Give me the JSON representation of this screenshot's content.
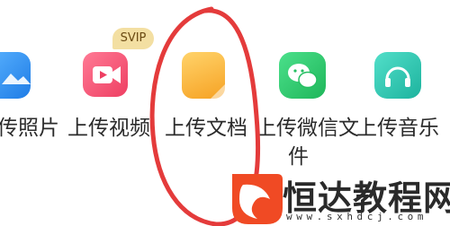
{
  "upload_options": [
    {
      "label": "传照片",
      "icon": "photo-icon",
      "color": "#2e8cf2"
    },
    {
      "label": "上传视频",
      "icon": "video-icon",
      "color": "#f04f6e",
      "badge": "SVIP"
    },
    {
      "label": "上传文档",
      "icon": "document-icon",
      "color": "#f8b53c"
    },
    {
      "label": "上传微信文",
      "label_line2": "件",
      "icon": "wechat-icon",
      "color": "#2ecb69"
    },
    {
      "label": "上传音乐",
      "icon": "music-icon",
      "color": "#2bc7b1"
    }
  ],
  "annotation": {
    "color": "#e43b3b"
  },
  "watermark": {
    "brand": "恒达教程网",
    "url": "www.sxhdcj.com",
    "logo": "fox-tail-logo",
    "logo_color": "#f04a24"
  }
}
